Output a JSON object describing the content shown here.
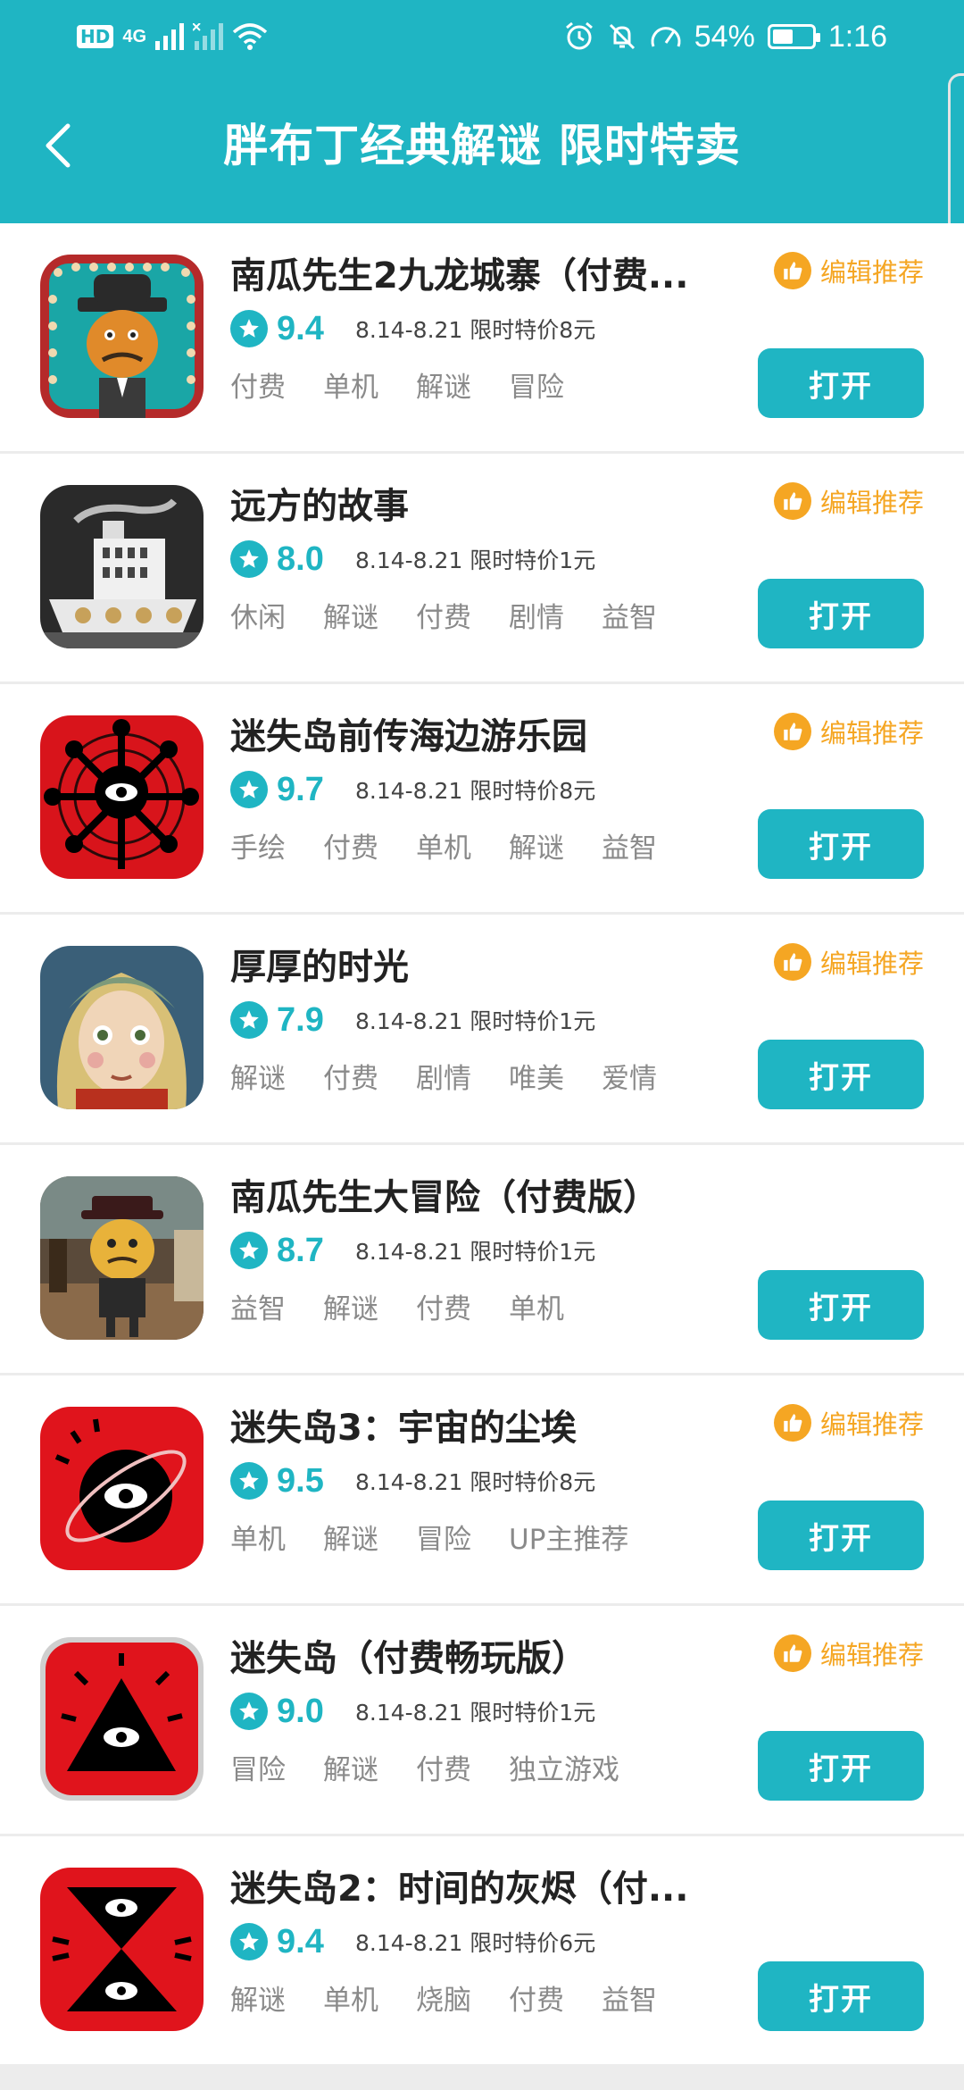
{
  "status_bar": {
    "hd": "HD",
    "net": "4G",
    "battery_percent": "54%",
    "battery_level": 0.54,
    "time": "1:16"
  },
  "header": {
    "title": "胖布丁经典解谜 限时特卖",
    "back_icon": "chevron-left-icon"
  },
  "colors": {
    "accent": "#1fb5c3",
    "editor": "#f5a623",
    "tag": "#8a8a8a"
  },
  "apps": [
    {
      "name": "南瓜先生2九龙城寨（付费...",
      "score": "9.4",
      "promo": "8.14-8.21 限时特价8元",
      "tags": [
        "付费",
        "单机",
        "解谜",
        "冒险"
      ],
      "editor": "编辑推荐",
      "button": "打开",
      "icon": "pumpkin-man-icon"
    },
    {
      "name": "远方的故事",
      "score": "8.0",
      "promo": "8.14-8.21 限时特价1元",
      "tags": [
        "休闲",
        "解谜",
        "付费",
        "剧情",
        "益智"
      ],
      "editor": "编辑推荐",
      "button": "打开",
      "icon": "steamship-icon"
    },
    {
      "name": "迷失岛前传海边游乐园",
      "score": "9.7",
      "promo": "8.14-8.21 限时特价8元",
      "tags": [
        "手绘",
        "付费",
        "单机",
        "解谜",
        "益智"
      ],
      "editor": "编辑推荐",
      "button": "打开",
      "icon": "eye-wheel-icon"
    },
    {
      "name": "厚厚的时光",
      "score": "7.9",
      "promo": "8.14-8.21 限时特价1元",
      "tags": [
        "解谜",
        "付费",
        "剧情",
        "唯美",
        "爱情"
      ],
      "editor": "编辑推荐",
      "button": "打开",
      "icon": "girl-portrait-icon"
    },
    {
      "name": "南瓜先生大冒险（付费版）",
      "score": "8.7",
      "promo": "8.14-8.21 限时特价1元",
      "tags": [
        "益智",
        "解谜",
        "付费",
        "单机"
      ],
      "editor": "",
      "button": "打开",
      "icon": "pumpkin-adventure-icon"
    },
    {
      "name": "迷失岛3：宇宙的尘埃",
      "score": "9.5",
      "promo": "8.14-8.21 限时特价8元",
      "tags": [
        "单机",
        "解谜",
        "冒险",
        "UP主推荐"
      ],
      "editor": "编辑推荐",
      "button": "打开",
      "icon": "eye-planet-icon"
    },
    {
      "name": "迷失岛（付费畅玩版）",
      "score": "9.0",
      "promo": "8.14-8.21 限时特价1元",
      "tags": [
        "冒险",
        "解谜",
        "付费",
        "独立游戏"
      ],
      "editor": "编辑推荐",
      "button": "打开",
      "icon": "eye-pyramid-icon"
    },
    {
      "name": "迷失岛2：时间的灰烬（付...",
      "score": "9.4",
      "promo": "8.14-8.21 限时特价6元",
      "tags": [
        "解谜",
        "单机",
        "烧脑",
        "付费",
        "益智"
      ],
      "editor": "",
      "button": "打开",
      "icon": "eye-hourglass-icon"
    }
  ]
}
